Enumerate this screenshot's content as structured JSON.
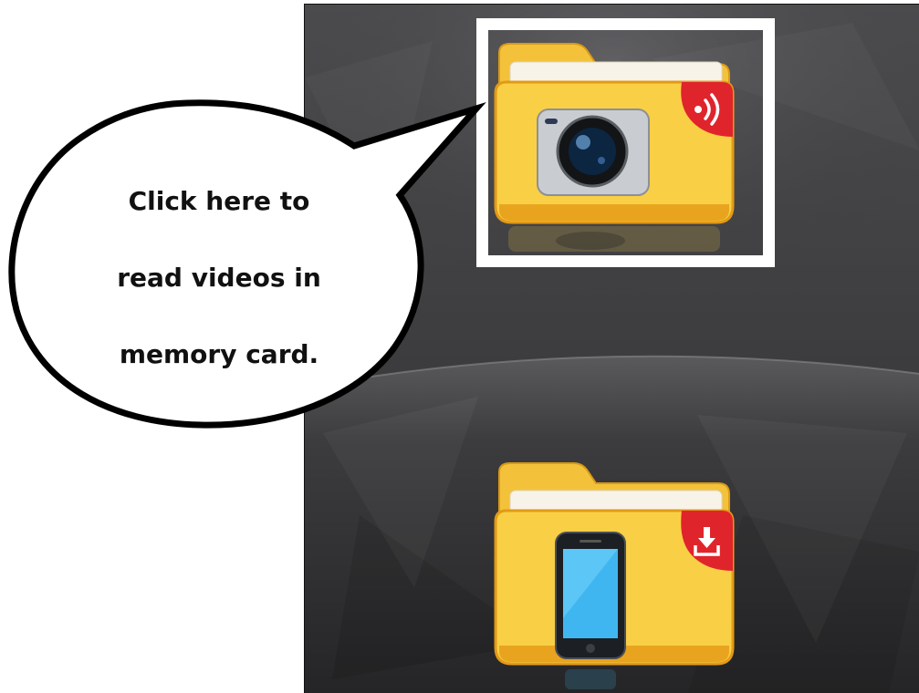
{
  "app": {
    "colors": {
      "background_dark": "#2b2b2d",
      "background_light": "#4a4a4d",
      "folder_yellow": "#f7c93a",
      "folder_orange": "#e49a17",
      "badge_red": "#e0242c",
      "highlight": "#ffffff"
    },
    "folders": [
      {
        "name": "camera-memory-card-folder",
        "icon": "camera-icon",
        "badge_icon": "wifi-signal-icon"
      },
      {
        "name": "phone-download-folder",
        "icon": "smartphone-icon",
        "badge_icon": "download-icon"
      }
    ]
  },
  "callout": {
    "lines": [
      "Click here to",
      "read videos in",
      "memory card."
    ]
  }
}
